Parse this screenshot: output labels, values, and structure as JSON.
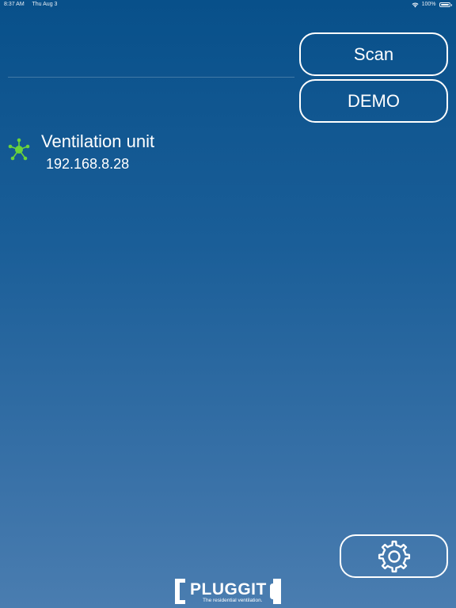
{
  "status_bar": {
    "time": "8:37 AM",
    "date": "Thu Aug 3",
    "battery": "100%",
    "battery_level": 1.0
  },
  "actions": {
    "scan_label": "Scan",
    "demo_label": "DEMO"
  },
  "devices": [
    {
      "name": "Ventilation unit",
      "ip": "192.168.8.28",
      "icon": "network-node-icon",
      "icon_color": "#6ad33a"
    }
  ],
  "settings": {
    "icon": "gear-icon"
  },
  "brand": {
    "logo_text": "PLUGGIT",
    "tagline": "The residential ventilation."
  },
  "colors": {
    "background_top": "#08508a",
    "background_bottom": "#4a7db0",
    "accent_green": "#6ad33a",
    "foreground": "#ffffff"
  }
}
